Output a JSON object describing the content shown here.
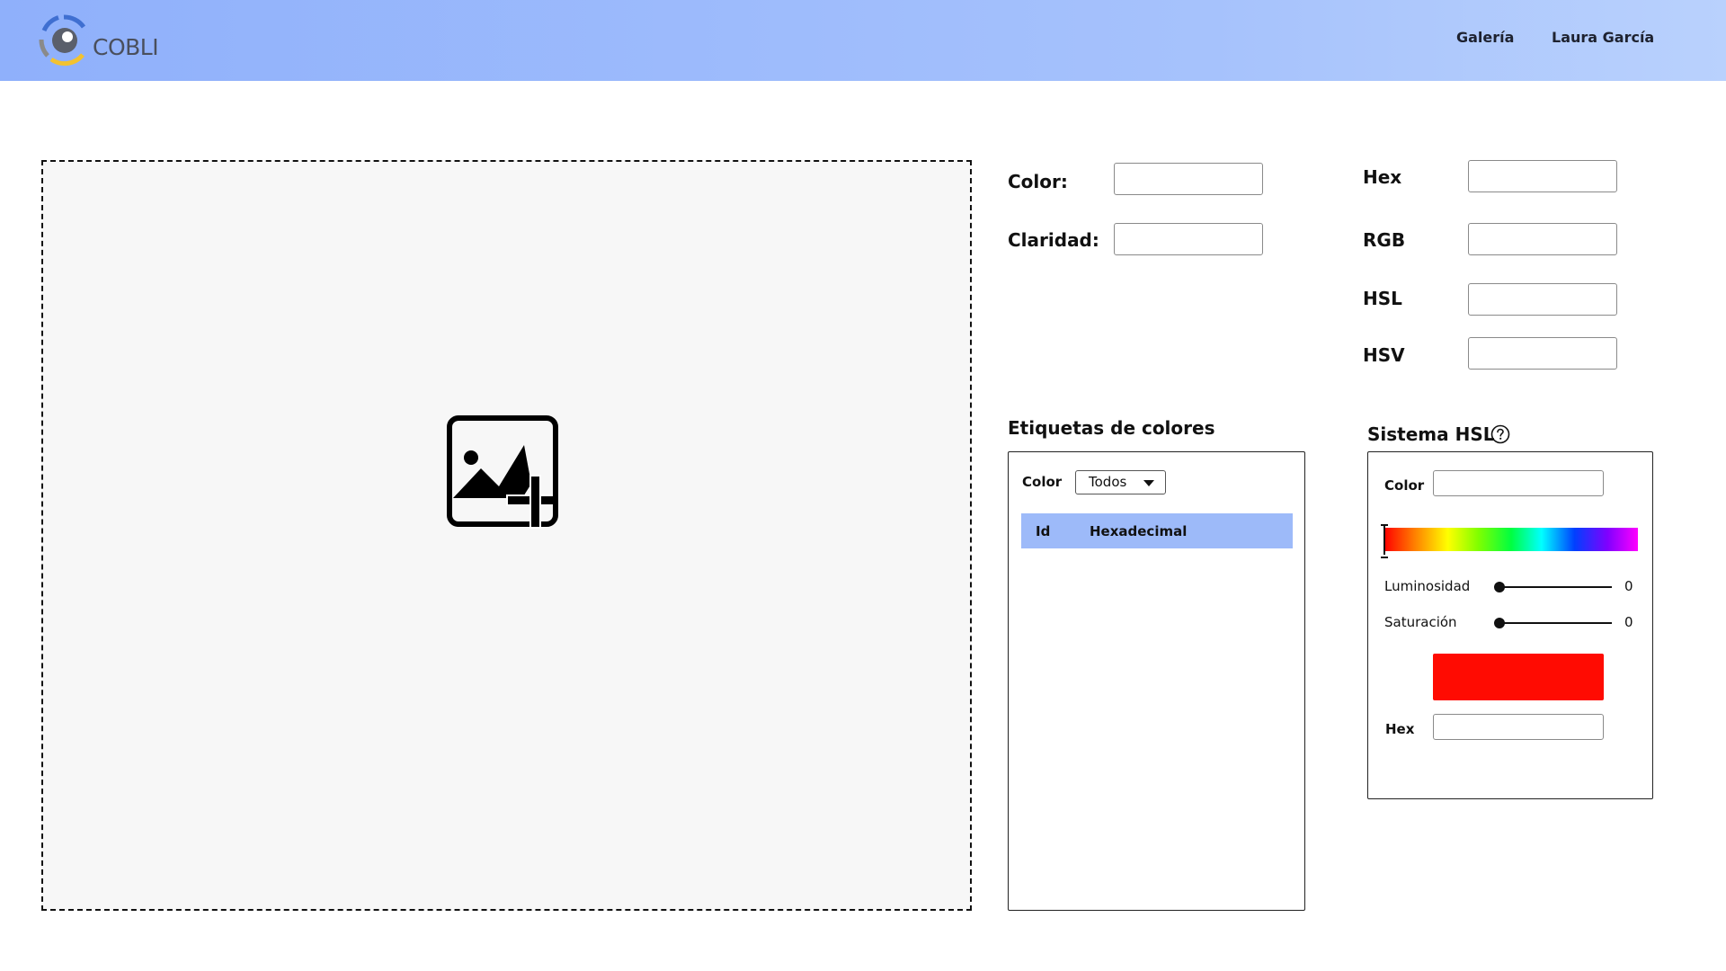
{
  "app": {
    "brand": "COBLI",
    "logo_icon": "eye-logo-icon"
  },
  "nav": {
    "gallery": "Galería",
    "user": "Laura García"
  },
  "upload": {
    "icon": "add-image-icon"
  },
  "color_info": {
    "color_label": "Color:",
    "color_value": "",
    "lightness_label": "Claridad:",
    "lightness_value": ""
  },
  "formats": {
    "hex_label": "Hex",
    "hex_value": "",
    "rgb_label": "RGB",
    "rgb_value": "",
    "hsl_label": "HSL",
    "hsl_value": "",
    "hsv_label": "HSV",
    "hsv_value": ""
  },
  "tags": {
    "title": "Etiquetas de colores",
    "filter_label": "Color",
    "filter_selected": "Todos",
    "columns": [
      "Id",
      "Hexadecimal"
    ],
    "rows": []
  },
  "hsl_system": {
    "title": "Sistema HSL",
    "help_icon": "question-circle-icon",
    "color_label": "Color",
    "color_value": "",
    "hue_value": 0,
    "luminosity_label": "Luminosidad",
    "luminosity_value": "0",
    "saturation_label": "Saturación",
    "saturation_value": "0",
    "swatch_color": "#ff0b02",
    "hex_label": "Hex",
    "hex_value": ""
  },
  "colors": {
    "header_gradient_start": "#8fb0fb",
    "header_gradient_end": "#b9d1fd",
    "table_header": "#9dbaf9"
  }
}
